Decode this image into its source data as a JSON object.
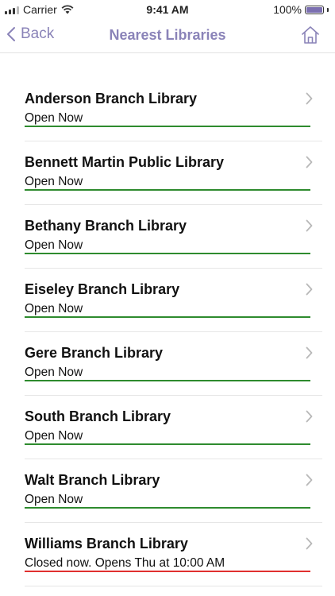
{
  "status_bar": {
    "carrier": "Carrier",
    "time": "9:41 AM",
    "battery": "100%",
    "battery_level": 1.0
  },
  "nav": {
    "back_label": "Back",
    "title": "Nearest Libraries",
    "home_icon": "home-icon"
  },
  "colors": {
    "accent": "#8a83b8",
    "open": "#2e8b2e",
    "closed": "#e0302f"
  },
  "libraries": [
    {
      "name": "Anderson Branch Library",
      "status": "Open Now",
      "state": "open"
    },
    {
      "name": "Bennett Martin Public Library",
      "status": "Open Now",
      "state": "open"
    },
    {
      "name": "Bethany Branch Library",
      "status": "Open Now",
      "state": "open"
    },
    {
      "name": "Eiseley Branch Library",
      "status": "Open Now",
      "state": "open"
    },
    {
      "name": "Gere Branch Library",
      "status": "Open Now",
      "state": "open"
    },
    {
      "name": "South Branch Library",
      "status": "Open Now",
      "state": "open"
    },
    {
      "name": "Walt Branch Library",
      "status": "Open Now",
      "state": "open"
    },
    {
      "name": "Williams Branch Library",
      "status": "Closed now. Opens Thu at 10:00 AM",
      "state": "closed"
    }
  ]
}
